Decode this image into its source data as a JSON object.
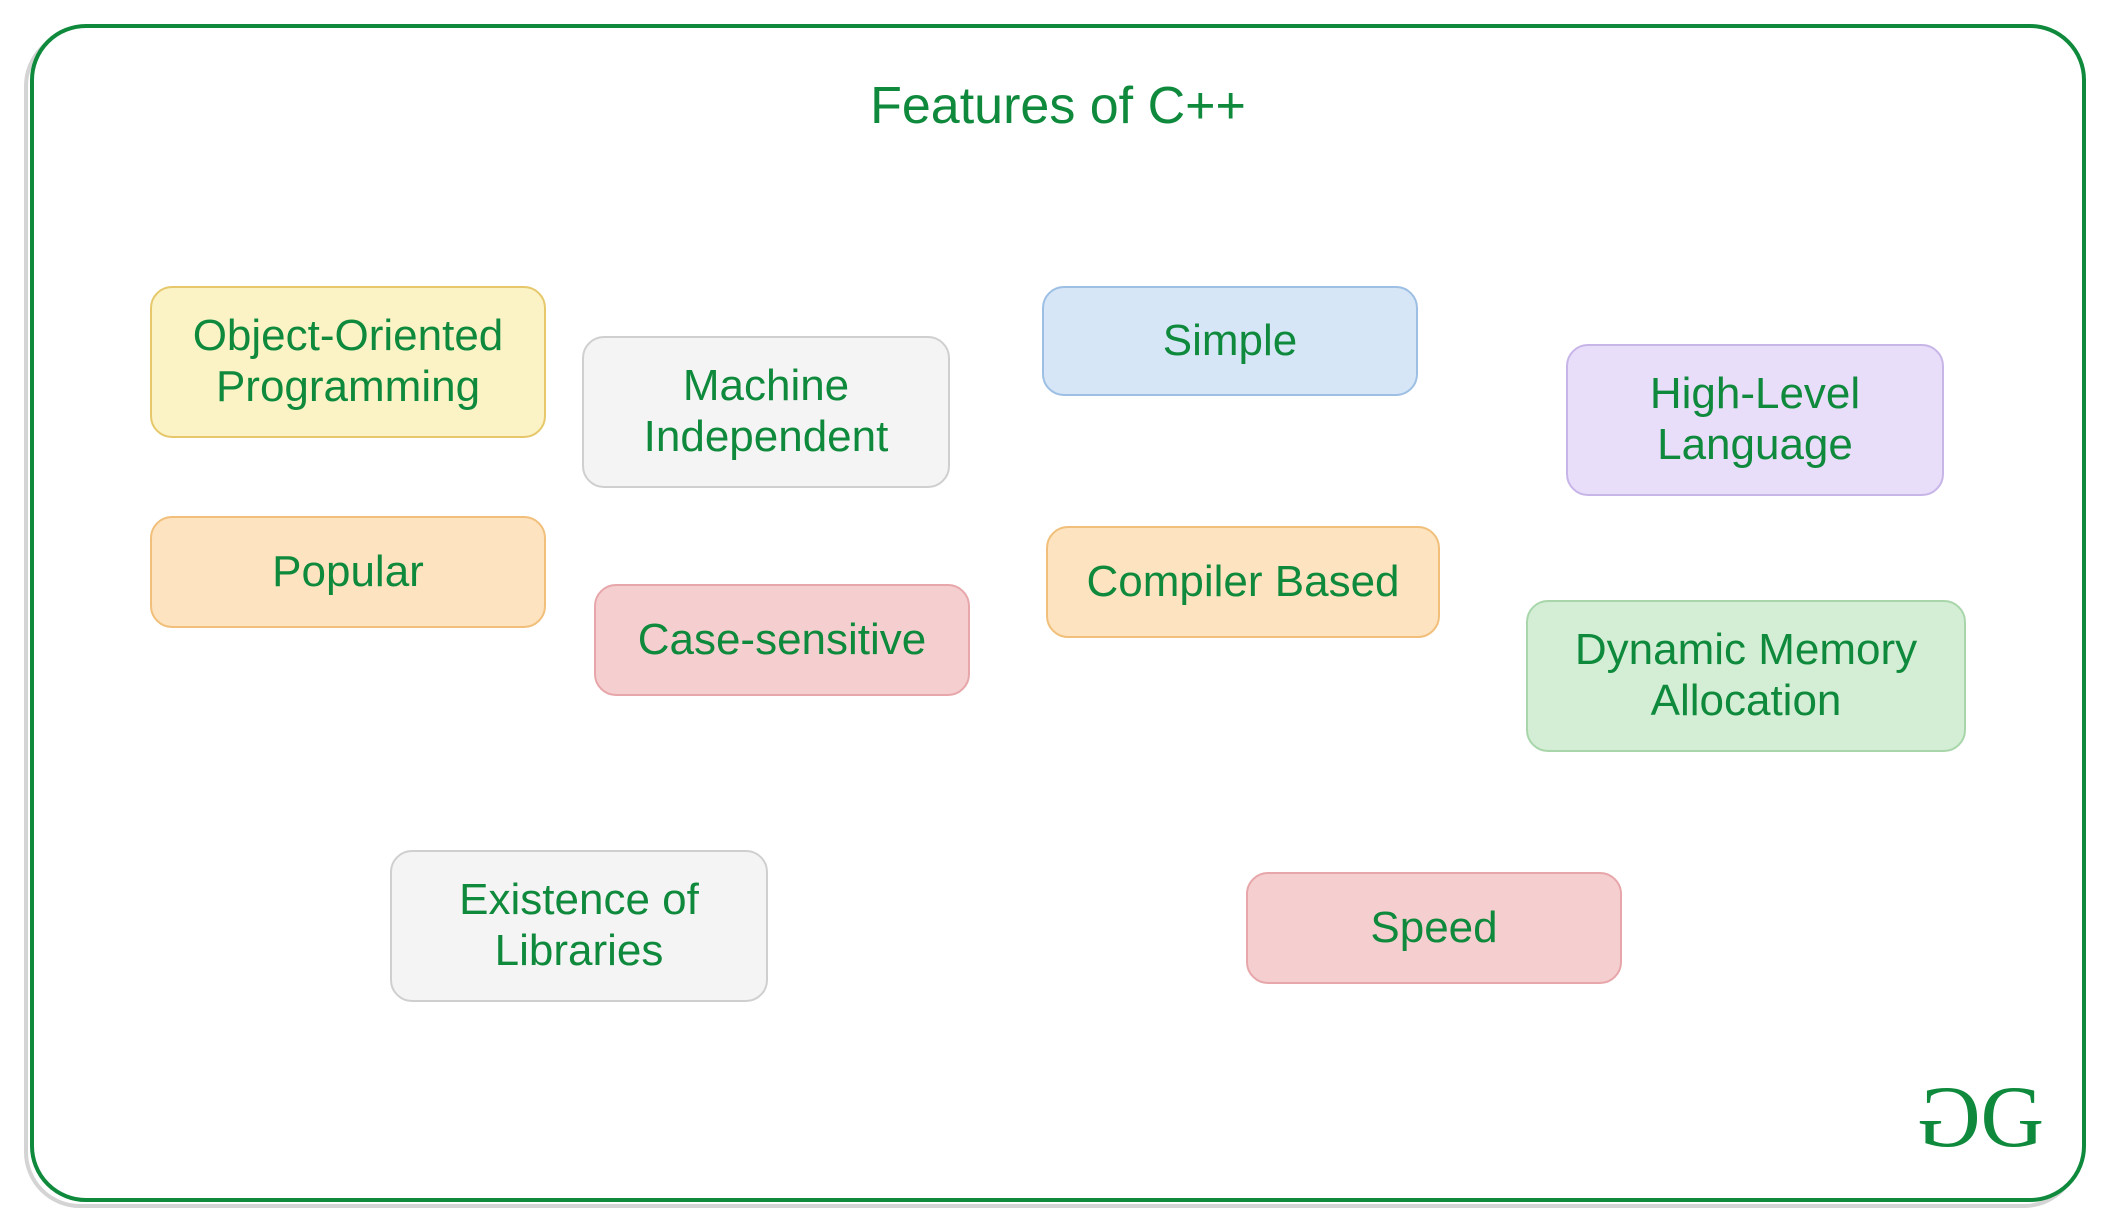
{
  "title": "Features of C++",
  "features": {
    "oop": "Object-Oriented Programming",
    "machine": "Machine Independent",
    "simple": "Simple",
    "high": "High-Level Language",
    "popular": "Popular",
    "case": "Case-sensitive",
    "compiler": "Compiler Based",
    "dma": "Dynamic Memory Allocation",
    "libs": "Existence of Libraries",
    "speed": "Speed"
  },
  "logo": {
    "left": "G",
    "right": "G"
  },
  "colors": {
    "accent": "#0f8a3d",
    "yellow": "#fbf3c6",
    "gray": "#f4f4f4",
    "blue": "#d6e6f7",
    "purple": "#e8defa",
    "orange": "#fde3bf",
    "red": "#f5cfd0",
    "green": "#d3eed4"
  }
}
